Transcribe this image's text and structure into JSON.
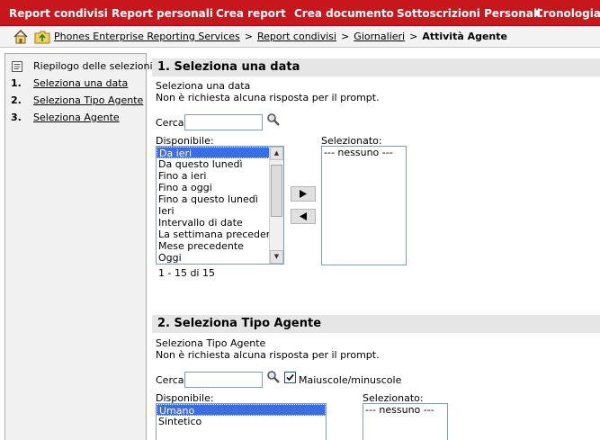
{
  "topnav": {
    "items": [
      "Report condivisi",
      "Report personali",
      "Crea report",
      "Crea documento",
      "Sottoscrizioni Personali",
      "Cronologia"
    ]
  },
  "breadcrumb": {
    "home_icon": "home-icon",
    "folder_icon": "folder-up-icon",
    "items": [
      "Phones Enterprise Reporting Services",
      "Report condivisi",
      "Giornalieri"
    ],
    "separator": ">",
    "current": "Attività Agente"
  },
  "sidebar": {
    "summary_label": "Riepilogo delle selezioni",
    "items": [
      {
        "num": "1.",
        "label": "Seleziona una data"
      },
      {
        "num": "2.",
        "label": "Seleziona Tipo Agente"
      },
      {
        "num": "3.",
        "label": "Seleziona Agente"
      }
    ]
  },
  "section1": {
    "title": "1.  Seleziona una data",
    "description": "Seleziona una data",
    "note": "Non è richiesta alcuna risposta per il prompt.",
    "search_label": "Cerca:",
    "search_value": "",
    "available_label": "Disponibile:",
    "selected_label": "Selezionato:",
    "available_options": [
      "Da ieri",
      "Da questo lunedì",
      "Fino a ieri",
      "Fino a oggi",
      "Fino a questo lunedì",
      "Ieri",
      "Intervallo di date",
      "La settimana precedente",
      "Mese precedente",
      "Oggi"
    ],
    "highlighted_option": "Da ieri",
    "selected_options": [
      "--- nessuno ---"
    ],
    "count_text": "1 - 15 di 15",
    "add_icon": "right-arrow-icon",
    "remove_icon": "left-arrow-icon"
  },
  "section2": {
    "title": "2.  Seleziona Tipo Agente",
    "description": "Seleziona Tipo Agente",
    "note": "Non è richiesta alcuna risposta per il prompt.",
    "search_label": "Cerca:",
    "search_value": "",
    "case_checkbox_label": "Maiuscole/minuscole",
    "case_checked": true,
    "available_label": "Disponibile:",
    "selected_label": "Selezionato:",
    "available_options": [
      "Umano",
      "Sintetico"
    ],
    "highlighted_option": "Umano",
    "selected_options": [
      "--- nessuno ---"
    ]
  },
  "colors": {
    "nav_bg": "#c8171c",
    "section_header_bg": "#e6e6e6",
    "selection_bg": "#3a6ee8"
  }
}
